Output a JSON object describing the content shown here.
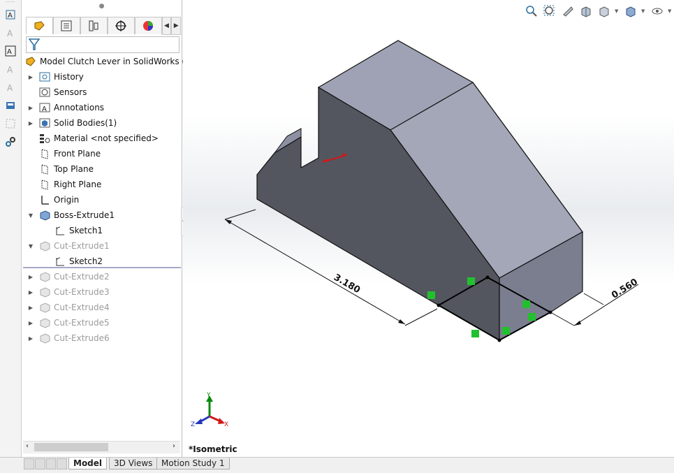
{
  "left_toolbar": {
    "icons": [
      "smart-dimension-icon",
      "note-icon",
      "autoballoon-icon",
      "balloon-icon",
      "stacked-balloon-icon",
      "surface-finish-icon",
      "datum-icon",
      "mate-reference-icon"
    ]
  },
  "feature_manager": {
    "tabs": [
      "featuremanager-tab",
      "propertymanager-tab",
      "configurationmanager-tab",
      "dimxpert-tab",
      "display-manager-tab"
    ],
    "root_label": "Model Clutch Lever in SolidWorks  (De",
    "items": [
      {
        "label": "History",
        "icon": "history-icon",
        "expander": "▶",
        "suppressed": false
      },
      {
        "label": "Sensors",
        "icon": "sensors-icon",
        "expander": "",
        "suppressed": false
      },
      {
        "label": "Annotations",
        "icon": "annotations-icon",
        "expander": "▶",
        "suppressed": false
      },
      {
        "label": "Solid Bodies(1)",
        "icon": "solid-bodies-icon",
        "expander": "▶",
        "suppressed": false
      },
      {
        "label": "Material <not specified>",
        "icon": "material-icon",
        "expander": "",
        "suppressed": false
      },
      {
        "label": "Front Plane",
        "icon": "plane-icon",
        "expander": "",
        "suppressed": false
      },
      {
        "label": "Top Plane",
        "icon": "plane-icon",
        "expander": "",
        "suppressed": false
      },
      {
        "label": "Right Plane",
        "icon": "plane-icon",
        "expander": "",
        "suppressed": false
      },
      {
        "label": "Origin",
        "icon": "origin-icon",
        "expander": "",
        "suppressed": false
      },
      {
        "label": "Boss-Extrude1",
        "icon": "boss-extrude-icon",
        "expander": "▼",
        "suppressed": false
      },
      {
        "label": "Sketch1",
        "icon": "sketch-icon",
        "expander": "",
        "suppressed": false,
        "child": true
      },
      {
        "label": "Cut-Extrude1",
        "icon": "cut-extrude-icon",
        "expander": "▼",
        "suppressed": true
      },
      {
        "label": "Sketch2",
        "icon": "sketch-icon",
        "expander": "",
        "suppressed": false,
        "child": true
      },
      {
        "label": "Cut-Extrude2",
        "icon": "cut-extrude-icon",
        "expander": "▶",
        "suppressed": true
      },
      {
        "label": "Cut-Extrude3",
        "icon": "cut-extrude-icon",
        "expander": "▶",
        "suppressed": true
      },
      {
        "label": "Cut-Extrude4",
        "icon": "cut-extrude-icon",
        "expander": "▶",
        "suppressed": true
      },
      {
        "label": "Cut-Extrude5",
        "icon": "cut-extrude-icon",
        "expander": "▶",
        "suppressed": true
      },
      {
        "label": "Cut-Extrude6",
        "icon": "cut-extrude-icon",
        "expander": "▶",
        "suppressed": true
      }
    ]
  },
  "viewport": {
    "view_name": "*Isometric",
    "dim_length": "3.180",
    "dim_width": "0.560",
    "triad": {
      "x": "X",
      "y": "Y",
      "z": "Z"
    },
    "heads_up_icons": [
      "zoom-to-fit-icon",
      "zoom-to-area-icon",
      "previous-view-icon",
      "section-view-icon",
      "view-orientation-icon",
      "display-style-icon",
      "hide-show-items-icon"
    ]
  },
  "bottom_tabs": [
    "Model",
    "3D Views",
    "Motion Study 1"
  ],
  "colors": {
    "body_top": "#9fa2b4",
    "body_side": "#54565f",
    "body_front": "#7b7e8f",
    "sketch_green": "#22c02f"
  }
}
